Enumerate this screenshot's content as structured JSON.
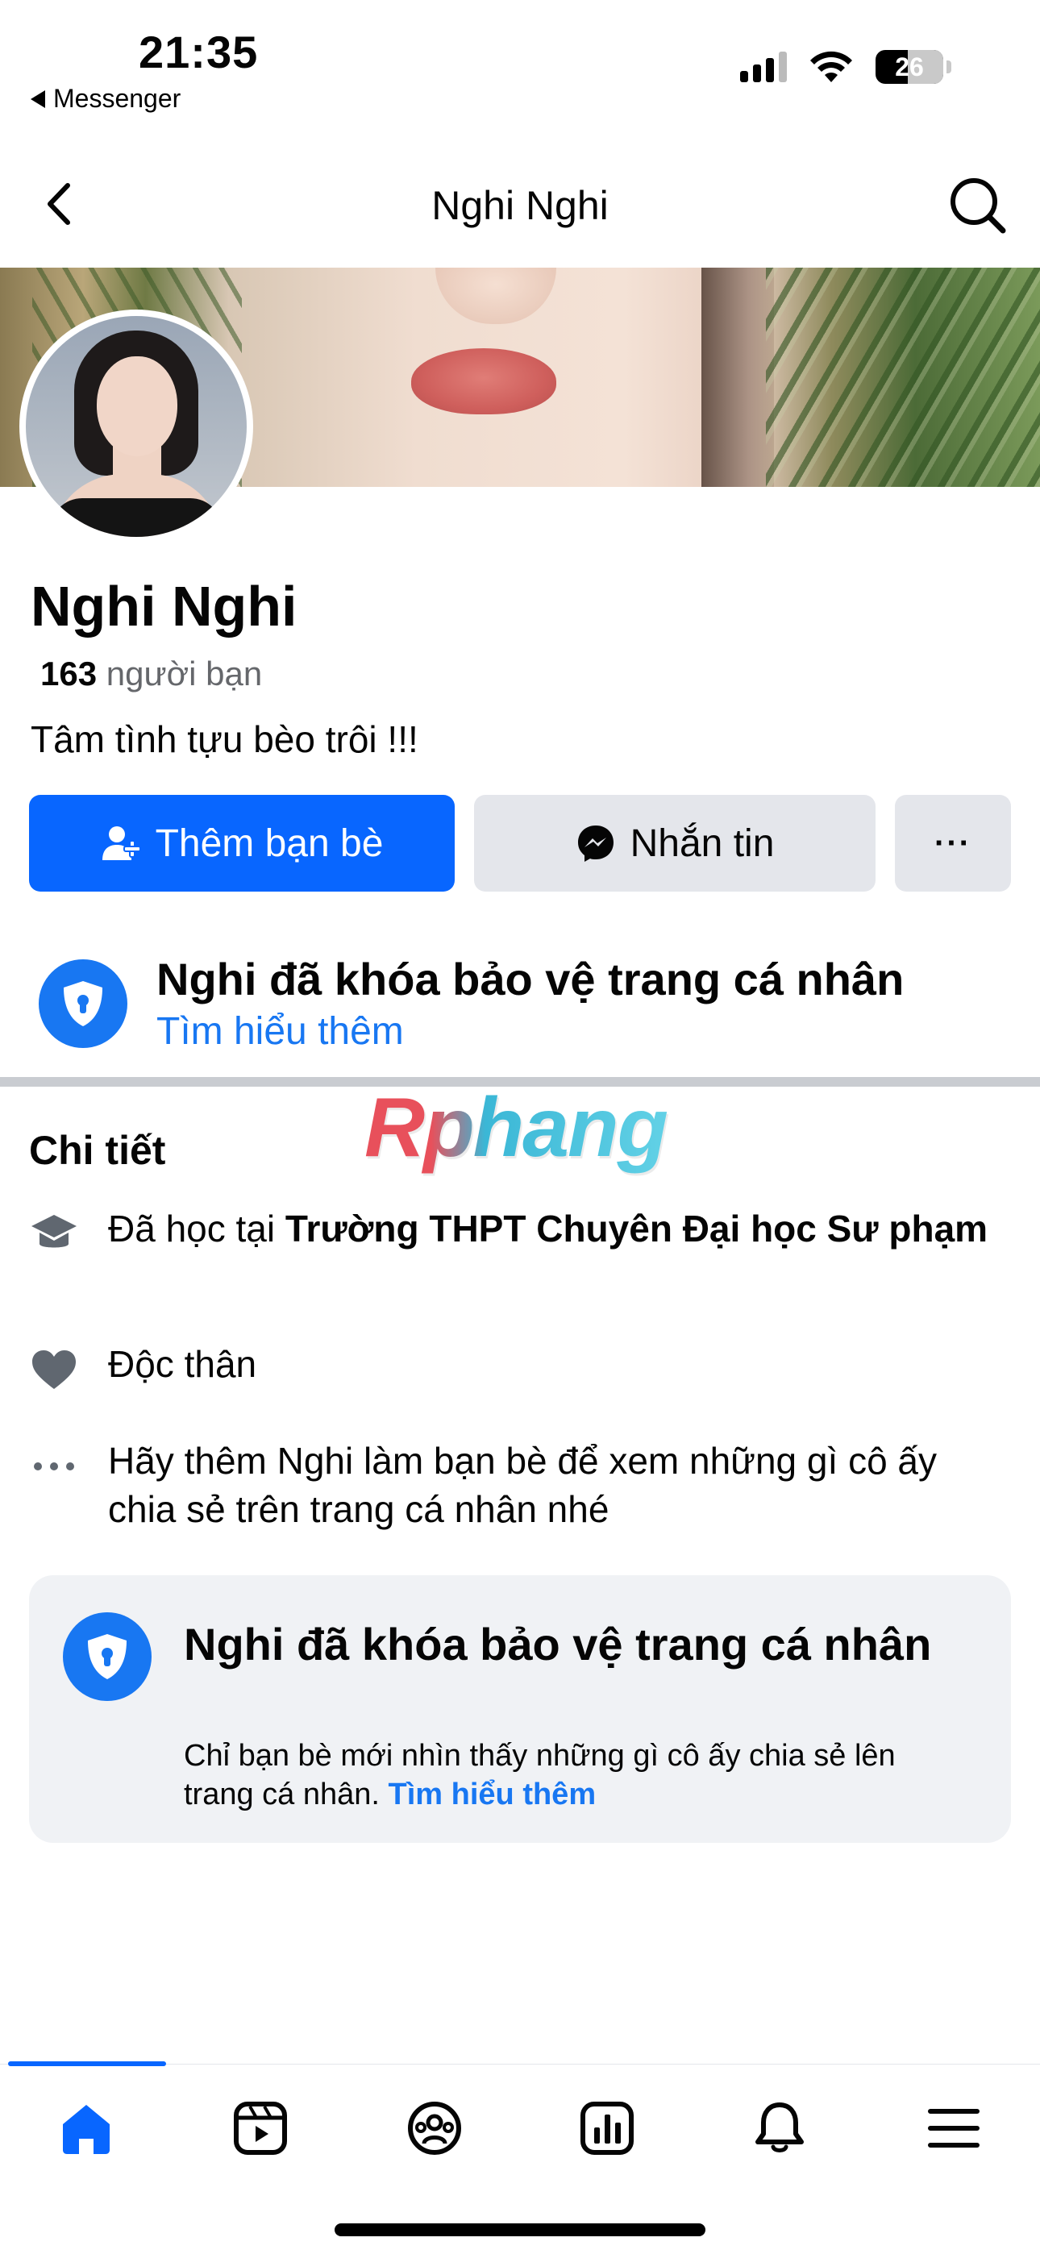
{
  "status_bar": {
    "time": "21:35",
    "back_app": "Messenger",
    "battery": "26"
  },
  "nav": {
    "title": "Nghi Nghi"
  },
  "profile": {
    "name": "Nghi Nghi",
    "friends_count": "163",
    "friends_label": "người bạn",
    "bio": "Tâm tình tựu bèo trôi !!!"
  },
  "actions": {
    "add_friend_label": "Thêm bạn bè",
    "message_label": "Nhắn tin",
    "more_label": "···"
  },
  "lock_banner": {
    "title": "Nghi đã khóa bảo vệ trang cá nhân",
    "link": "Tìm hiểu thêm"
  },
  "watermark": "Rphang",
  "details": {
    "title": "Chi tiết",
    "education_prefix": "Đã học tại",
    "education_school": "Trường THPT Chuyên Đại học Sư phạm",
    "relationship": "Độc thân",
    "more_info": "Hãy thêm Nghi làm bạn bè để xem những gì cô ấy chia sẻ trên trang cá nhân nhé"
  },
  "lock_card": {
    "title": "Nghi đã khóa bảo vệ trang cá nhân",
    "subtitle": "Chỉ bạn bè mới nhìn thấy những gì cô ấy chia sẻ lên trang cá nhân.",
    "link": "Tìm hiểu thêm"
  },
  "tabs": [
    {
      "icon": "home-icon",
      "active": true
    },
    {
      "icon": "video-icon",
      "active": false
    },
    {
      "icon": "groups-icon",
      "active": false
    },
    {
      "icon": "dashboard-icon",
      "active": false
    },
    {
      "icon": "bell-icon",
      "active": false
    },
    {
      "icon": "menu-icon",
      "active": false
    }
  ],
  "colors": {
    "primary": "#0866ff",
    "link": "#1877f2",
    "secondary_button": "#e4e6eb"
  }
}
